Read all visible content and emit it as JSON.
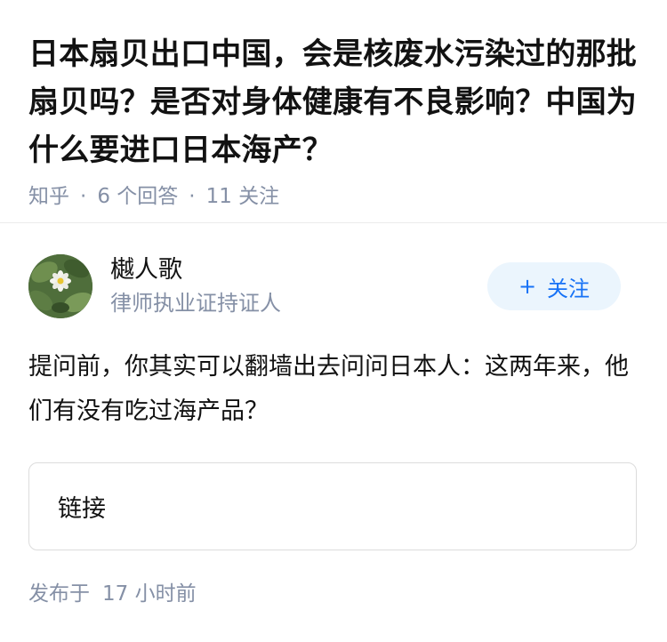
{
  "question": {
    "title": "日本扇贝出口中国，会是核废水污染过的那批扇贝吗？是否对身体健康有不良影响？中国为什么要进口日本海产？",
    "source": "知乎",
    "separator": "·",
    "answers_count": "6 个回答",
    "followers_count": "11 关注"
  },
  "answer": {
    "author": {
      "name": "樾人歌",
      "bio": "律师执业证持证人",
      "avatar_icon": "flower-avatar"
    },
    "follow_button": {
      "plus": "+",
      "label": "关注"
    },
    "text": "提问前，你其实可以翻墙出去问问日本人：这两年来，他们有没有吃过海产品？",
    "link_card": {
      "label": "链接"
    },
    "published_prefix": "发布于",
    "published_time": "17 小时前"
  },
  "colors": {
    "text": "#121212",
    "meta": "#8590a6",
    "accent": "#1772f6",
    "follow_bg": "#ebf5fd",
    "card_border": "#dcdcdc"
  }
}
